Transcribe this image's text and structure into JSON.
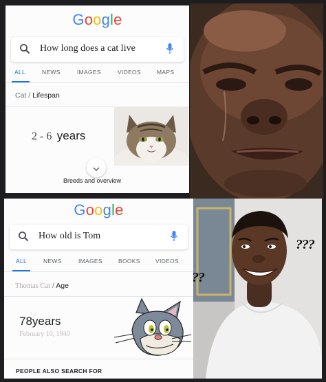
{
  "top_panel": {
    "logo": "Google",
    "query": "How long does a cat live",
    "tabs": [
      "ALL",
      "NEWS",
      "IMAGES",
      "VIDEOS",
      "MAPS"
    ],
    "breadcrumb": {
      "parent": "Cat",
      "sep": "/",
      "child": "Lifespan"
    },
    "answer_num": "2 - 6",
    "answer_unit": "years",
    "footer": "Breeds and overview"
  },
  "bottom_panel": {
    "logo": "Google",
    "query": "How old is Tom",
    "tabs": [
      "ALL",
      "NEWS",
      "IMAGES",
      "BOOKS",
      "VIDEOS"
    ],
    "breadcrumb": {
      "parent": "Thomas Cat",
      "sep": "/",
      "child": "Age"
    },
    "answer_num": "78",
    "answer_unit": "years",
    "answer_sub": "February 10, 1940",
    "footer": "PEOPLE ALSO SEARCH FOR"
  },
  "photo_bottom": {
    "q_right": "???",
    "q_left": "??"
  },
  "icons": [
    "search-icon",
    "mic-icon",
    "chevron-down-icon"
  ],
  "colors": {
    "accent": "#1a73e8",
    "google_blue": "#4285f4",
    "google_red": "#ea4335",
    "google_yellow": "#fbbc05",
    "google_green": "#34a853"
  }
}
